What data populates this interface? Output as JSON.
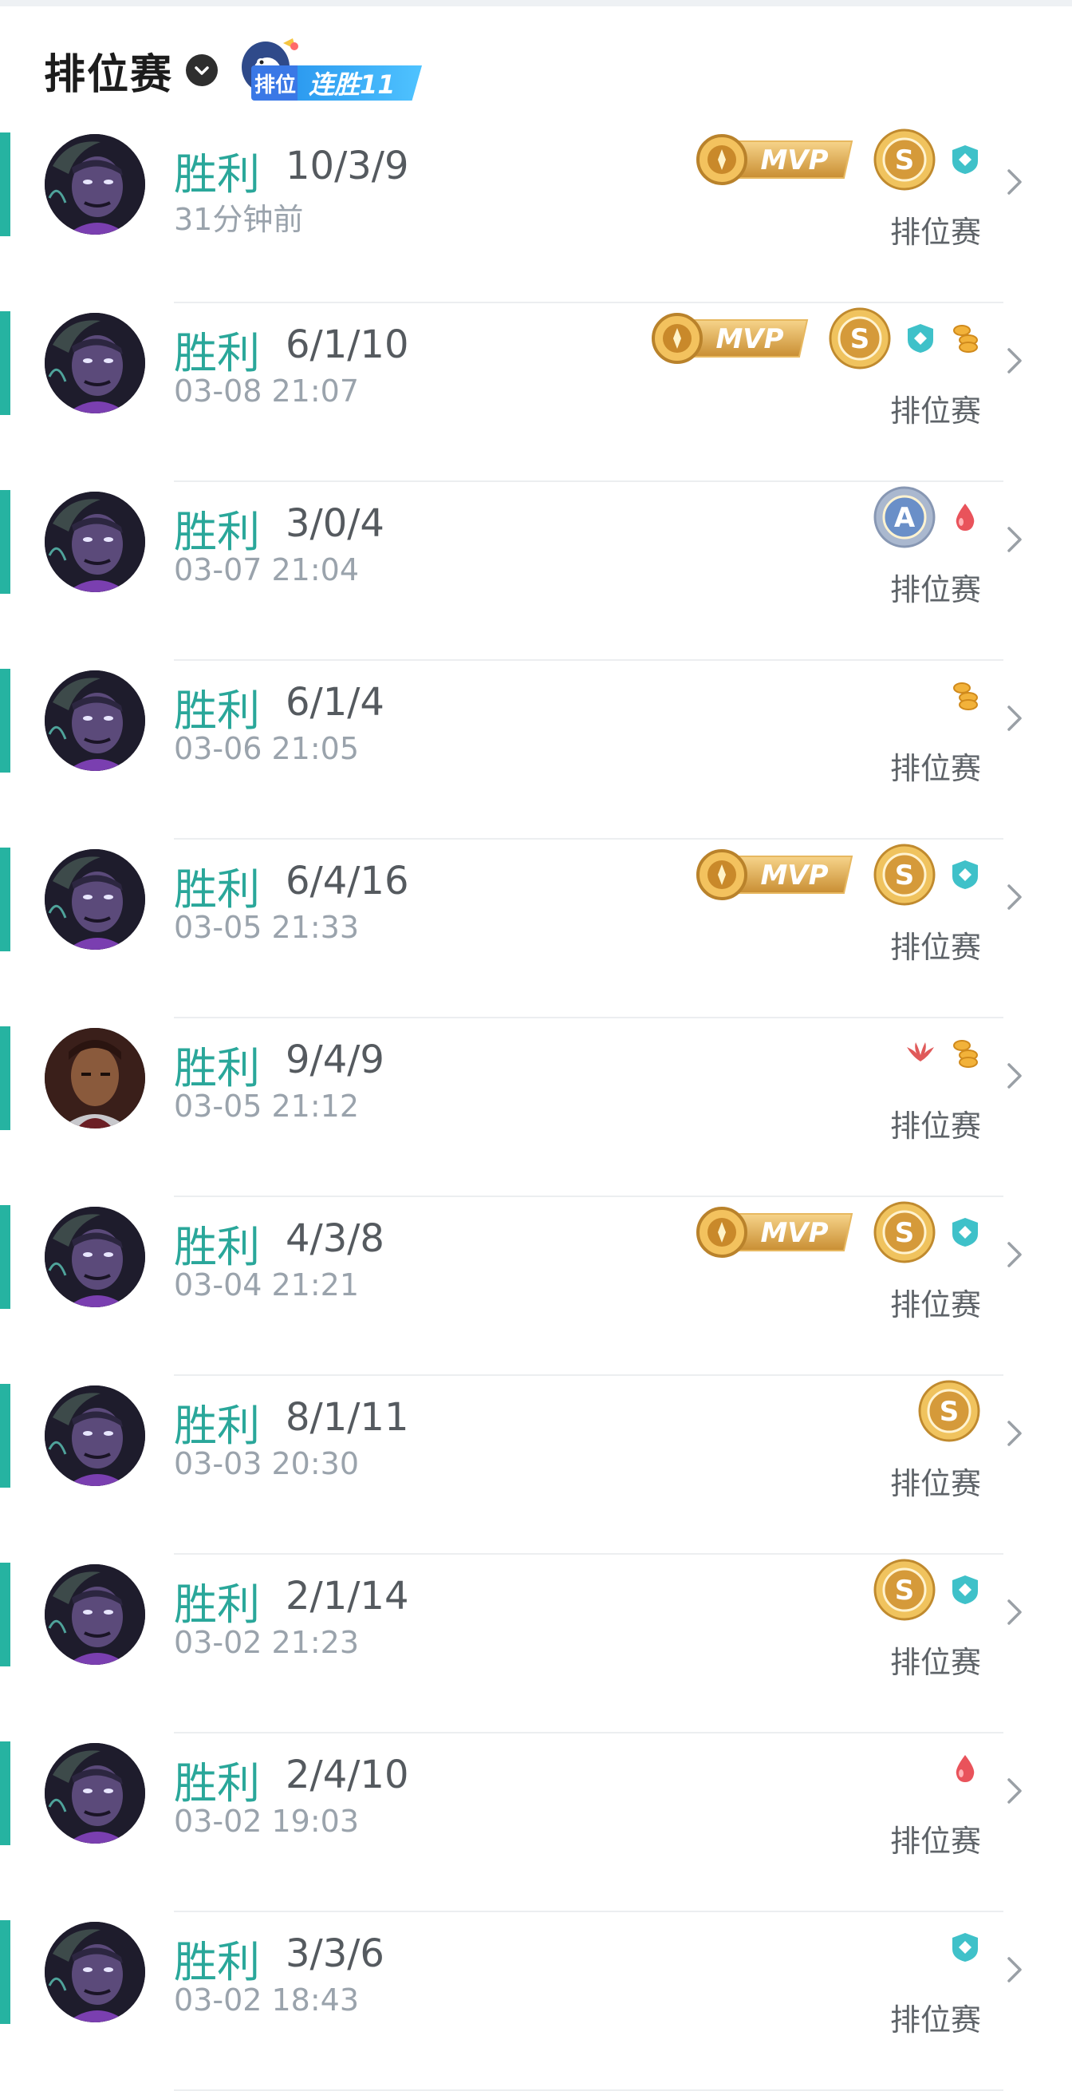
{
  "header": {
    "title": "排位赛",
    "streak_tag": "排位",
    "streak_label": "连胜11"
  },
  "matches": [
    {
      "result": "胜利",
      "kda": "10/3/9",
      "time": "31分钟前",
      "mode": "排位赛",
      "hero": "purple",
      "badges": [
        "mvp",
        "medal-s",
        "shield"
      ]
    },
    {
      "result": "胜利",
      "kda": "6/1/10",
      "time": "03-08 21:07",
      "mode": "排位赛",
      "hero": "purple",
      "badges": [
        "mvp",
        "medal-s",
        "shield",
        "coins"
      ]
    },
    {
      "result": "胜利",
      "kda": "3/0/4",
      "time": "03-07 21:04",
      "mode": "排位赛",
      "hero": "purple",
      "badges": [
        "medal-a",
        "blood"
      ]
    },
    {
      "result": "胜利",
      "kda": "6/1/4",
      "time": "03-06 21:05",
      "mode": "排位赛",
      "hero": "purple",
      "badges": [
        "coins"
      ]
    },
    {
      "result": "胜利",
      "kda": "6/4/16",
      "time": "03-05 21:33",
      "mode": "排位赛",
      "hero": "purple",
      "badges": [
        "mvp",
        "medal-s",
        "shield"
      ]
    },
    {
      "result": "胜利",
      "kda": "9/4/9",
      "time": "03-05 21:12",
      "mode": "排位赛",
      "hero": "brown",
      "badges": [
        "wings",
        "coins"
      ]
    },
    {
      "result": "胜利",
      "kda": "4/3/8",
      "time": "03-04 21:21",
      "mode": "排位赛",
      "hero": "purple",
      "badges": [
        "mvp",
        "medal-s",
        "shield"
      ]
    },
    {
      "result": "胜利",
      "kda": "8/1/11",
      "time": "03-03 20:30",
      "mode": "排位赛",
      "hero": "purple",
      "badges": [
        "medal-s"
      ]
    },
    {
      "result": "胜利",
      "kda": "2/1/14",
      "time": "03-02 21:23",
      "mode": "排位赛",
      "hero": "purple",
      "badges": [
        "medal-s",
        "shield"
      ]
    },
    {
      "result": "胜利",
      "kda": "2/4/10",
      "time": "03-02 19:03",
      "mode": "排位赛",
      "hero": "purple",
      "badges": [
        "blood"
      ]
    },
    {
      "result": "胜利",
      "kda": "3/3/6",
      "time": "03-02 18:43",
      "mode": "排位赛",
      "hero": "purple",
      "badges": [
        "shield"
      ]
    }
  ],
  "badge_text": {
    "mvp": "MVP",
    "medal_s": "S",
    "medal_a": "A"
  },
  "colors": {
    "accent": "#26b3a1",
    "result_text": "#2aa79a",
    "gold": "#d9a44a",
    "shield": "#3fc1c9",
    "blood": "#e9535b"
  }
}
